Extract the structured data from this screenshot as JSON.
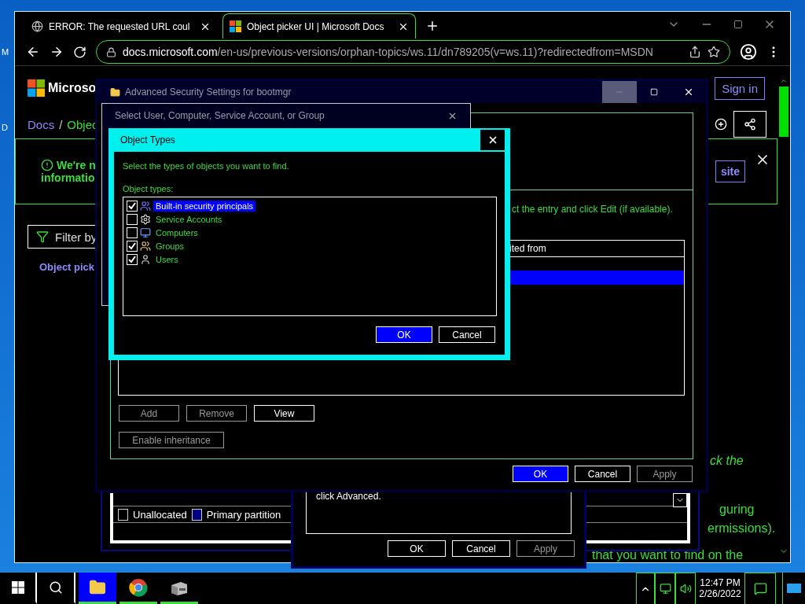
{
  "desktop": {
    "labels": [
      "M",
      "D"
    ]
  },
  "browser": {
    "tabs": [
      {
        "title": "ERROR: The requested URL coul",
        "selected": false
      },
      {
        "title": "Object picker UI | Microsoft Docs",
        "selected": true
      }
    ],
    "url": {
      "host": "docs.microsoft.com",
      "path": "/en-us/previous-versions/orphan-topics/ws.11/dn789205(v=ws.11)?redirectedfrom=MSDN"
    },
    "page": {
      "brand": "Microso",
      "sign_in": "Sign in",
      "breadcrumb": [
        "Docs",
        "/",
        "Objec"
      ],
      "banner": [
        "We're n",
        "informatio"
      ],
      "banner_button": "site",
      "filter": "Filter by",
      "toc_item": "Object pick",
      "fragments": [
        {
          "text": "ck the",
          "kind": "italic"
        },
        {
          "text": "guring",
          "kind": "plain"
        },
        {
          "text": "ermissions).",
          "kind": "plain"
        },
        {
          "text": "that you want to find on the",
          "kind": "plain"
        }
      ]
    }
  },
  "disk_window": {
    "legend": [
      {
        "label": "Unallocated",
        "color": "#000000"
      },
      {
        "label": "Primary partition",
        "color": "#000080"
      }
    ]
  },
  "properties_dialog": {
    "text": "click Advanced.",
    "buttons": [
      {
        "label": "OK",
        "disabled": false
      },
      {
        "label": "Cancel",
        "disabled": false
      },
      {
        "label": "Apply",
        "disabled": true
      }
    ]
  },
  "advanced_security": {
    "title": "Advanced Security Settings for bootmgr",
    "instruction": "ct the entry and click Edit (if available).",
    "column_header": "ited from",
    "buttons": [
      {
        "label": "Add",
        "disabled": true
      },
      {
        "label": "Remove",
        "disabled": true
      },
      {
        "label": "View",
        "disabled": false
      }
    ],
    "inheritance_button": {
      "label": "Enable inheritance",
      "disabled": true
    },
    "footer_buttons": [
      {
        "label": "OK",
        "default": true,
        "disabled": false
      },
      {
        "label": "Cancel",
        "default": false,
        "disabled": false
      },
      {
        "label": "Apply",
        "default": false,
        "disabled": true
      }
    ]
  },
  "select_user": {
    "title": "Select User, Computer, Service Account, or Group"
  },
  "object_types": {
    "title": "Object Types",
    "prompt": "Select the types of objects you want to find.",
    "list_label": "Object types:",
    "items": [
      {
        "label": "Built-in security principals",
        "kind": "principals",
        "checked": true,
        "selected": true
      },
      {
        "label": "Service Accounts",
        "kind": "service",
        "checked": false,
        "selected": false
      },
      {
        "label": "Computers",
        "kind": "computer",
        "checked": false,
        "selected": false
      },
      {
        "label": "Groups",
        "kind": "group",
        "checked": true,
        "selected": false
      },
      {
        "label": "Users",
        "kind": "user",
        "checked": true,
        "selected": false
      }
    ],
    "buttons": [
      {
        "label": "OK",
        "default": true
      },
      {
        "label": "Cancel",
        "default": false
      }
    ]
  },
  "taskbar": {
    "apps": [
      {
        "kind": "explorer",
        "active": true
      },
      {
        "kind": "chrome",
        "active": false
      },
      {
        "kind": "server",
        "active": false
      }
    ],
    "time": "12:47 PM",
    "date": "2/26/2022"
  }
}
